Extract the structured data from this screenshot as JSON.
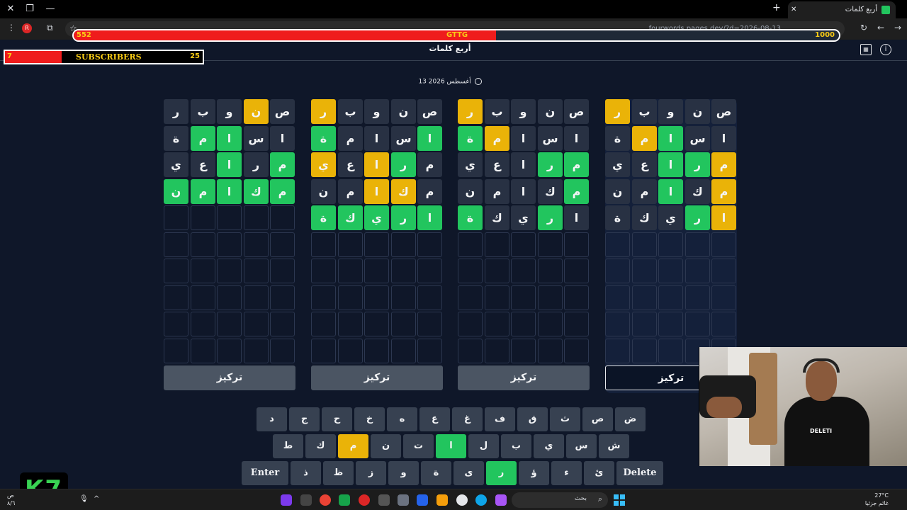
{
  "browser": {
    "tab_title": "أربع كلمات",
    "url": "fourwords.pages.dev/?d=2026-08-13",
    "profile_initial": "R"
  },
  "overlays": {
    "stream_bar": {
      "current": "552",
      "label": "GTTG",
      "goal": "1000",
      "progress": 0.552
    },
    "subscribers": {
      "label": "SUBSCRIBERS",
      "current": "7",
      "goal": "25",
      "progress": 0.28
    },
    "logo_text": "K7",
    "webcam_shirt_text": "DELETI"
  },
  "app": {
    "title": "أربع كلمات",
    "date": "13 أغسطس 2026",
    "focus_label": "تركيز"
  },
  "boards": [
    {
      "rows": [
        [
          [
            "ر",
            "gray"
          ],
          [
            "ب",
            "gray"
          ],
          [
            "و",
            "gray"
          ],
          [
            "ن",
            "yellow"
          ],
          [
            "ص",
            "gray"
          ]
        ],
        [
          [
            "ة",
            "gray"
          ],
          [
            "م",
            "green"
          ],
          [
            "ا",
            "green"
          ],
          [
            "س",
            "gray"
          ],
          [
            "ا",
            "gray"
          ]
        ],
        [
          [
            "ي",
            "gray"
          ],
          [
            "ع",
            "gray"
          ],
          [
            "ا",
            "green"
          ],
          [
            "ر",
            "gray"
          ],
          [
            "م",
            "green"
          ]
        ],
        [
          [
            "ن",
            "green"
          ],
          [
            "م",
            "green"
          ],
          [
            "ا",
            "green"
          ],
          [
            "ك",
            "green"
          ],
          [
            "م",
            "green"
          ]
        ]
      ]
    },
    {
      "rows": [
        [
          [
            "ر",
            "yellow"
          ],
          [
            "ب",
            "gray"
          ],
          [
            "و",
            "gray"
          ],
          [
            "ن",
            "gray"
          ],
          [
            "ص",
            "gray"
          ]
        ],
        [
          [
            "ة",
            "green"
          ],
          [
            "م",
            "gray"
          ],
          [
            "ا",
            "gray"
          ],
          [
            "س",
            "gray"
          ],
          [
            "ا",
            "green"
          ]
        ],
        [
          [
            "ي",
            "yellow"
          ],
          [
            "ع",
            "gray"
          ],
          [
            "ا",
            "yellow"
          ],
          [
            "ر",
            "green"
          ],
          [
            "م",
            "gray"
          ]
        ],
        [
          [
            "ن",
            "gray"
          ],
          [
            "م",
            "gray"
          ],
          [
            "ا",
            "yellow"
          ],
          [
            "ك",
            "yellow"
          ],
          [
            "م",
            "gray"
          ]
        ],
        [
          [
            "ة",
            "green"
          ],
          [
            "ك",
            "green"
          ],
          [
            "ي",
            "green"
          ],
          [
            "ر",
            "green"
          ],
          [
            "ا",
            "green"
          ]
        ]
      ]
    },
    {
      "rows": [
        [
          [
            "ر",
            "yellow"
          ],
          [
            "ب",
            "gray"
          ],
          [
            "و",
            "gray"
          ],
          [
            "ن",
            "gray"
          ],
          [
            "ص",
            "gray"
          ]
        ],
        [
          [
            "ة",
            "green"
          ],
          [
            "م",
            "yellow"
          ],
          [
            "ا",
            "gray"
          ],
          [
            "س",
            "gray"
          ],
          [
            "ا",
            "gray"
          ]
        ],
        [
          [
            "ي",
            "gray"
          ],
          [
            "ع",
            "gray"
          ],
          [
            "ا",
            "gray"
          ],
          [
            "ر",
            "green"
          ],
          [
            "م",
            "green"
          ]
        ],
        [
          [
            "ن",
            "gray"
          ],
          [
            "م",
            "gray"
          ],
          [
            "ا",
            "gray"
          ],
          [
            "ك",
            "gray"
          ],
          [
            "م",
            "green"
          ]
        ],
        [
          [
            "ة",
            "green"
          ],
          [
            "ك",
            "gray"
          ],
          [
            "ي",
            "gray"
          ],
          [
            "ر",
            "green"
          ],
          [
            "ا",
            "gray"
          ]
        ]
      ]
    },
    {
      "rows": [
        [
          [
            "ر",
            "yellow"
          ],
          [
            "ب",
            "gray"
          ],
          [
            "و",
            "gray"
          ],
          [
            "ن",
            "gray"
          ],
          [
            "ص",
            "gray"
          ]
        ],
        [
          [
            "ة",
            "gray"
          ],
          [
            "م",
            "yellow"
          ],
          [
            "ا",
            "green"
          ],
          [
            "س",
            "gray"
          ],
          [
            "ا",
            "gray"
          ]
        ],
        [
          [
            "ي",
            "gray"
          ],
          [
            "ع",
            "gray"
          ],
          [
            "ا",
            "green"
          ],
          [
            "ر",
            "green"
          ],
          [
            "م",
            "yellow"
          ]
        ],
        [
          [
            "ن",
            "gray"
          ],
          [
            "م",
            "gray"
          ],
          [
            "ا",
            "green"
          ],
          [
            "ك",
            "gray"
          ],
          [
            "م",
            "yellow"
          ]
        ],
        [
          [
            "ة",
            "gray"
          ],
          [
            "ك",
            "gray"
          ],
          [
            "ي",
            "gray"
          ],
          [
            "ر",
            "green"
          ],
          [
            "ا",
            "yellow"
          ]
        ]
      ]
    }
  ],
  "keyboard": {
    "rows": [
      [
        [
          "ض",
          ""
        ],
        [
          "ص",
          ""
        ],
        [
          "ث",
          ""
        ],
        [
          "ق",
          ""
        ],
        [
          "ف",
          ""
        ],
        [
          "غ",
          ""
        ],
        [
          "ع",
          ""
        ],
        [
          "ه",
          ""
        ],
        [
          "خ",
          ""
        ],
        [
          "ح",
          ""
        ],
        [
          "ج",
          ""
        ],
        [
          "د",
          ""
        ]
      ],
      [
        [
          "ش",
          ""
        ],
        [
          "س",
          ""
        ],
        [
          "ي",
          ""
        ],
        [
          "ب",
          ""
        ],
        [
          "ل",
          ""
        ],
        [
          "ا",
          "green"
        ],
        [
          "ت",
          ""
        ],
        [
          "ن",
          ""
        ],
        [
          "م",
          "yellow"
        ],
        [
          "ك",
          ""
        ],
        [
          "ط",
          ""
        ]
      ],
      [
        [
          "Delete",
          "wide"
        ],
        [
          "ئ",
          ""
        ],
        [
          "ء",
          ""
        ],
        [
          "ؤ",
          ""
        ],
        [
          "ر",
          "green"
        ],
        [
          "ى",
          ""
        ],
        [
          "ة",
          ""
        ],
        [
          "و",
          ""
        ],
        [
          "ز",
          ""
        ],
        [
          "ظ",
          ""
        ],
        [
          "ذ",
          ""
        ],
        [
          "Enter",
          "wide"
        ]
      ]
    ]
  },
  "taskbar": {
    "search_placeholder": "بحث",
    "weather_temp": "27°C",
    "weather_desc": "غائم جزئيا",
    "time_left": "ص",
    "date_left": "٨/٦"
  }
}
